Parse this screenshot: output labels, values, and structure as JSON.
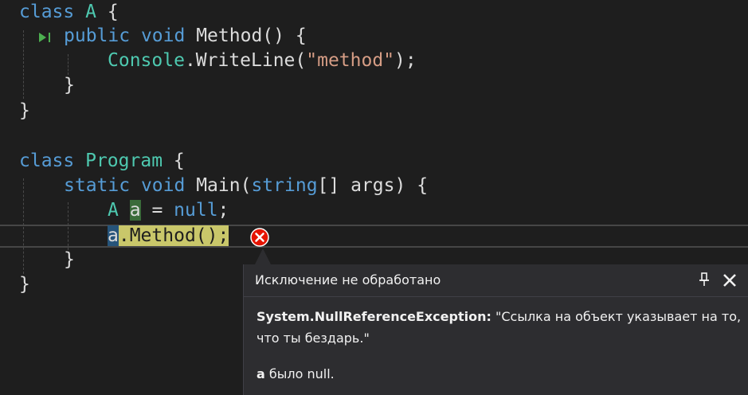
{
  "editor": {
    "lines": {
      "l1": {
        "kw_class": "class",
        "name": "A",
        "brace": "{"
      },
      "l2": {
        "kw_public": "public",
        "kw_void": "void",
        "method": "Method",
        "sig": "()",
        "brace": "{"
      },
      "l3": {
        "type": "Console",
        "call": ".WriteLine(",
        "str": "\"method\"",
        "end": ");"
      },
      "l4": {
        "brace": "}"
      },
      "l5": {
        "brace": "}"
      },
      "l7": {
        "kw_class": "class",
        "name": "Program",
        "brace": "{"
      },
      "l8": {
        "kw_static": "static",
        "kw_void": "void",
        "method": "Main(",
        "kw_string": "string",
        "args": "[] args)",
        "brace": "{"
      },
      "l9": {
        "type": "A",
        "var": "a",
        "assign": "=",
        "kw_null": "null",
        "end": ";"
      },
      "l10": {
        "var": "a",
        "call": ".Method();"
      },
      "l11": {
        "brace": "}"
      },
      "l12": {
        "brace": "}"
      }
    }
  },
  "exception_popup": {
    "title": "Исключение не обработано",
    "exception_type": "System.NullReferenceException:",
    "message_line1": "\"Ссылка на объект указывает на то,",
    "message_line2": "что ты бездарь.\"",
    "var_name": "a",
    "var_status": "было null."
  },
  "icons": {
    "error": "error-circle-icon",
    "pin": "pin-icon",
    "close": "close-icon",
    "codelens": "run-to-here-icon"
  },
  "colors": {
    "background": "#1e1e1e",
    "keyword": "#569cd6",
    "type": "#4ec9b0",
    "string": "#d69d85",
    "statement_highlight": "#c9c76a",
    "error": "#e51400"
  }
}
